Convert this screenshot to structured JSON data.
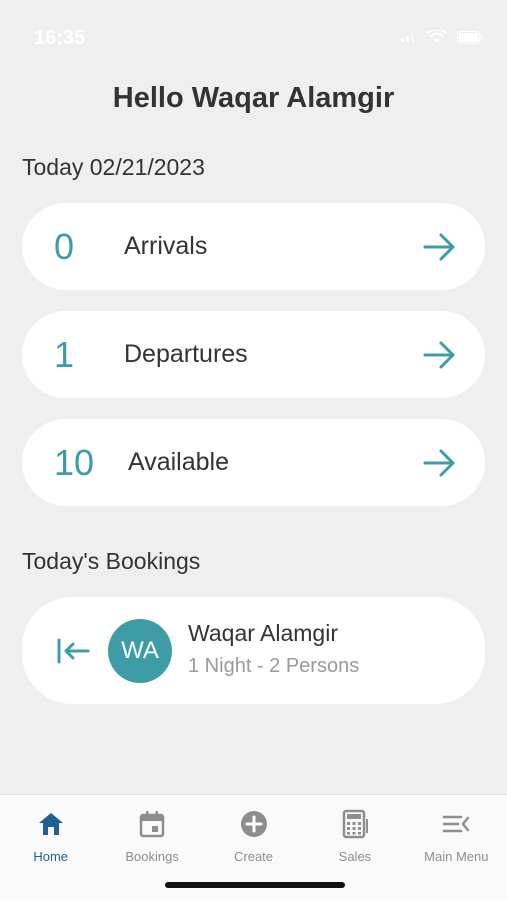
{
  "status_bar": {
    "time": "16:35"
  },
  "greeting": "Hello Waqar Alamgir",
  "today": {
    "label": "Today 02/21/2023"
  },
  "stats": [
    {
      "count": "0",
      "label": "Arrivals"
    },
    {
      "count": "1",
      "label": "Departures"
    },
    {
      "count": "10",
      "label": "Available"
    }
  ],
  "bookings_section": {
    "label": "Today's Bookings"
  },
  "bookings": [
    {
      "initials": "WA",
      "name": "Waqar Alamgir",
      "detail": "1 Night - 2 Persons"
    }
  ],
  "tabs": [
    {
      "label": "Home",
      "icon": "home-icon",
      "active": true
    },
    {
      "label": "Bookings",
      "icon": "calendar-icon",
      "active": false
    },
    {
      "label": "Create",
      "icon": "plus-circle-icon",
      "active": false
    },
    {
      "label": "Sales",
      "icon": "calculator-icon",
      "active": false
    },
    {
      "label": "Main Menu",
      "icon": "menu-collapse-icon",
      "active": false
    }
  ],
  "colors": {
    "accent": "#3d9ca6",
    "active_tab": "#1f5f93",
    "background": "#efefef",
    "card": "#ffffff"
  }
}
